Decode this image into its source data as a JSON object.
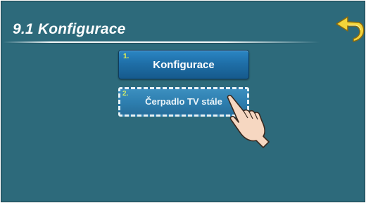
{
  "header": {
    "title": "9.1 Konfigurace"
  },
  "icons": {
    "back": "back-arrow-icon",
    "pointer": "pointing-hand-icon"
  },
  "colors": {
    "background": "#2d6a7b",
    "button": "#1f6fa8",
    "number": "#e8f14a"
  },
  "menu": {
    "items": [
      {
        "number": "1.",
        "label": "Konfigurace"
      },
      {
        "number": "2.",
        "label": "Čerpadlo TV stále"
      }
    ]
  }
}
